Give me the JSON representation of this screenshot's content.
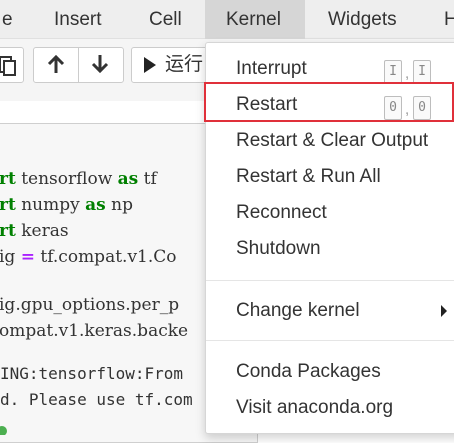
{
  "menubar": {
    "items": [
      {
        "label": "e"
      },
      {
        "label": "Insert"
      },
      {
        "label": "Cell"
      },
      {
        "label": "Kernel"
      },
      {
        "label": "Widgets"
      },
      {
        "label": "H"
      }
    ]
  },
  "toolbar": {
    "run_label": "运行"
  },
  "code": {
    "lines": [
      {
        "kw": "rt",
        "rest": " tensorflow ",
        "kw2": "as",
        "rest2": " tf"
      },
      {
        "kw": "rt",
        "rest": " numpy ",
        "kw2": "as",
        "rest2": " np"
      },
      {
        "kw": "rt",
        "rest": " keras"
      },
      {
        "pre": "ig ",
        "op": "=",
        "rest": " tf.compat.v1.Co"
      },
      {
        "text": "ig.gpu_options.per_p"
      },
      {
        "text": "ompat.v1.keras.backe"
      }
    ],
    "output": [
      "ING:tensorflow:From ",
      "d. Please use tf.com"
    ]
  },
  "kernel_menu": {
    "items": [
      {
        "label": "Interrupt",
        "shortcut": [
          "I",
          "I"
        ]
      },
      {
        "label": "Restart",
        "shortcut": [
          "0",
          "0"
        ]
      },
      {
        "label": "Restart & Clear Output"
      },
      {
        "label": "Restart & Run All"
      },
      {
        "label": "Reconnect"
      },
      {
        "label": "Shutdown"
      },
      {
        "label": "Change kernel"
      },
      {
        "label": "Conda Packages"
      },
      {
        "label": "Visit anaconda.org"
      }
    ],
    "shortcut_separator": ","
  },
  "colors": {
    "highlight_border": "#e0303a",
    "keyword": "#008000",
    "operator": "#aa22ff"
  }
}
